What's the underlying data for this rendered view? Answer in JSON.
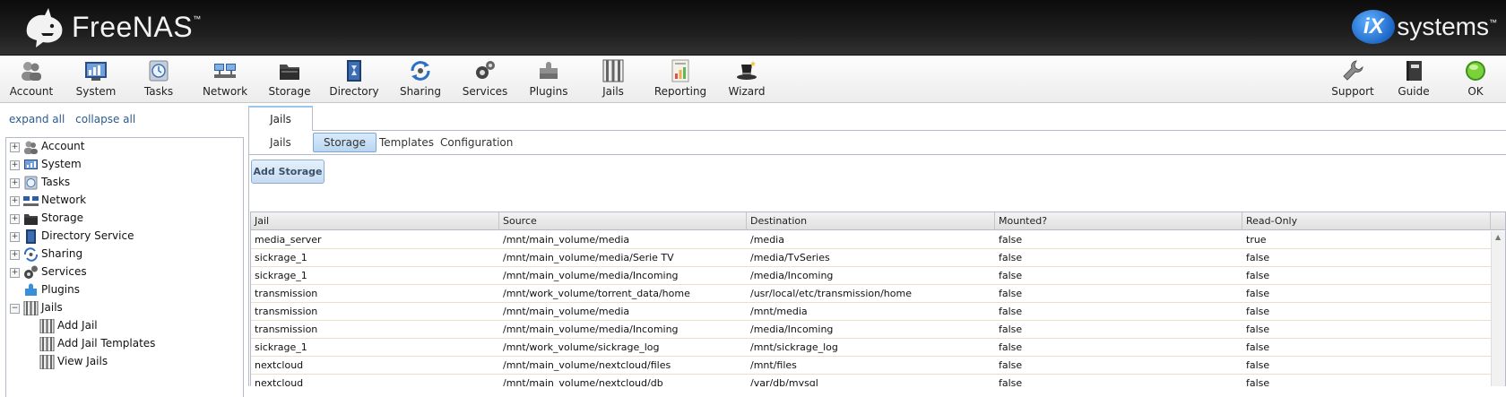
{
  "header": {
    "brand": "FreeNAS",
    "brand_mark": "™",
    "vendor_badge": "iX",
    "vendor": "systems",
    "vendor_mark": "™"
  },
  "toolbar": {
    "items": [
      {
        "label": "Account",
        "icon": "account-icon"
      },
      {
        "label": "System",
        "icon": "system-icon"
      },
      {
        "label": "Tasks",
        "icon": "tasks-icon"
      },
      {
        "label": "Network",
        "icon": "network-icon"
      },
      {
        "label": "Storage",
        "icon": "storage-icon"
      },
      {
        "label": "Directory",
        "icon": "directory-icon"
      },
      {
        "label": "Sharing",
        "icon": "sharing-icon"
      },
      {
        "label": "Services",
        "icon": "services-icon"
      },
      {
        "label": "Plugins",
        "icon": "plugins-icon"
      },
      {
        "label": "Jails",
        "icon": "jails-icon"
      },
      {
        "label": "Reporting",
        "icon": "reporting-icon"
      },
      {
        "label": "Wizard",
        "icon": "wizard-icon"
      }
    ],
    "right_items": [
      {
        "label": "Support",
        "icon": "support-icon"
      },
      {
        "label": "Guide",
        "icon": "guide-icon"
      },
      {
        "label": "OK",
        "icon": "status-ok-icon"
      }
    ]
  },
  "sidebar": {
    "expand_all": "expand all",
    "collapse_all": "collapse all",
    "tree": [
      {
        "label": "Account",
        "expander": "+"
      },
      {
        "label": "System",
        "expander": "+"
      },
      {
        "label": "Tasks",
        "expander": "+"
      },
      {
        "label": "Network",
        "expander": "+"
      },
      {
        "label": "Storage",
        "expander": "+"
      },
      {
        "label": "Directory Service",
        "expander": "+"
      },
      {
        "label": "Sharing",
        "expander": "+"
      },
      {
        "label": "Services",
        "expander": "+"
      },
      {
        "label": "Plugins",
        "expander": ""
      },
      {
        "label": "Jails",
        "expander": "−"
      },
      {
        "label": "Add Jail",
        "expander": ""
      },
      {
        "label": "Add Jail Templates",
        "expander": ""
      },
      {
        "label": "View Jails",
        "expander": ""
      }
    ]
  },
  "main": {
    "outer_tab": "Jails",
    "sub_tabs": [
      "Jails",
      "Storage",
      "Templates",
      "Configuration"
    ],
    "active_sub_tab": "Storage",
    "add_button": "Add Storage",
    "table": {
      "columns": [
        "Jail",
        "Source",
        "Destination",
        "Mounted?",
        "Read-Only"
      ],
      "rows": [
        [
          "media_server",
          "/mnt/main_volume/media",
          "/media",
          "false",
          "true"
        ],
        [
          "sickrage_1",
          "/mnt/main_volume/media/Serie TV",
          "/media/TvSeries",
          "false",
          "false"
        ],
        [
          "sickrage_1",
          "/mnt/main_volume/media/Incoming",
          "/media/Incoming",
          "false",
          "false"
        ],
        [
          "transmission",
          "/mnt/work_volume/torrent_data/home",
          "/usr/local/etc/transmission/home",
          "false",
          "false"
        ],
        [
          "transmission",
          "/mnt/main_volume/media",
          "/mnt/media",
          "false",
          "false"
        ],
        [
          "transmission",
          "/mnt/main_volume/media/Incoming",
          "/media/Incoming",
          "false",
          "false"
        ],
        [
          "sickrage_1",
          "/mnt/work_volume/sickrage_log",
          "/mnt/sickrage_log",
          "false",
          "false"
        ],
        [
          "nextcloud",
          "/mnt/main_volume/nextcloud/files",
          "/mnt/files",
          "false",
          "false"
        ],
        [
          "nextcloud",
          "/mnt/main_volume/nextcloud/db",
          "/var/db/mysql",
          "false",
          "false"
        ]
      ]
    }
  }
}
